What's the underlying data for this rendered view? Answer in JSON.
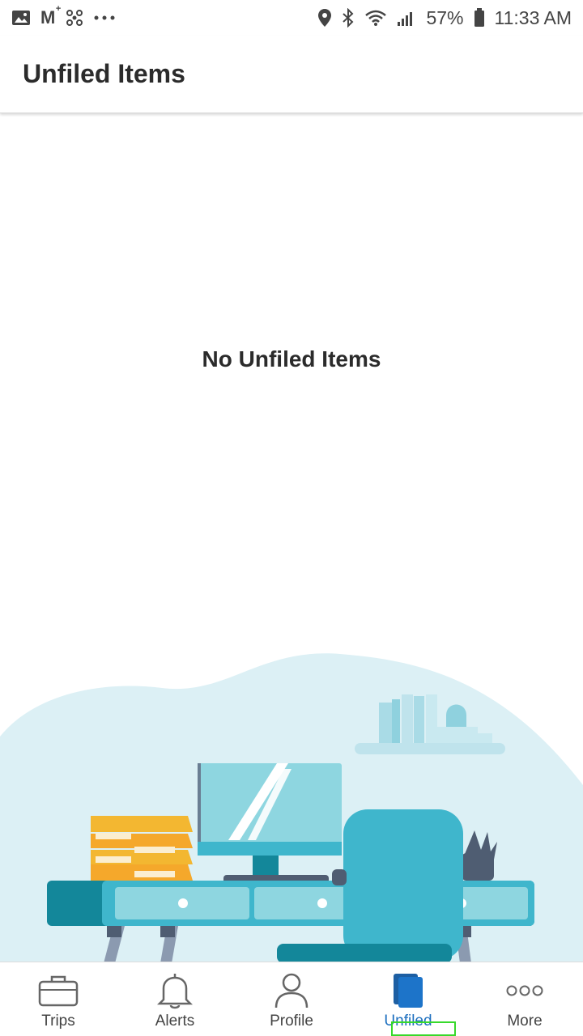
{
  "status_bar": {
    "battery": "57%",
    "time": "11:33 AM",
    "icons_left": [
      "image-icon",
      "gmail-icon",
      "fan-icon",
      "more-dots-icon"
    ],
    "icons_right": [
      "location-icon",
      "bluetooth-icon",
      "wifi-icon",
      "signal-icon",
      "battery-icon"
    ]
  },
  "header": {
    "title": "Unfiled Items"
  },
  "main": {
    "empty_message": "No Unfiled Items"
  },
  "bottom_nav": {
    "items": [
      {
        "label": "Trips",
        "icon": "briefcase-icon"
      },
      {
        "label": "Alerts",
        "icon": "bell-icon"
      },
      {
        "label": "Profile",
        "icon": "person-icon"
      },
      {
        "label": "Unfiled",
        "icon": "unfiled-icon",
        "active": true
      },
      {
        "label": "More",
        "icon": "more-icon"
      }
    ]
  },
  "colors": {
    "accent": "#1d6fbf",
    "illustration_bg": "#dcf0f5",
    "desk": "#3fb6cc",
    "folder": "#f3b731"
  }
}
